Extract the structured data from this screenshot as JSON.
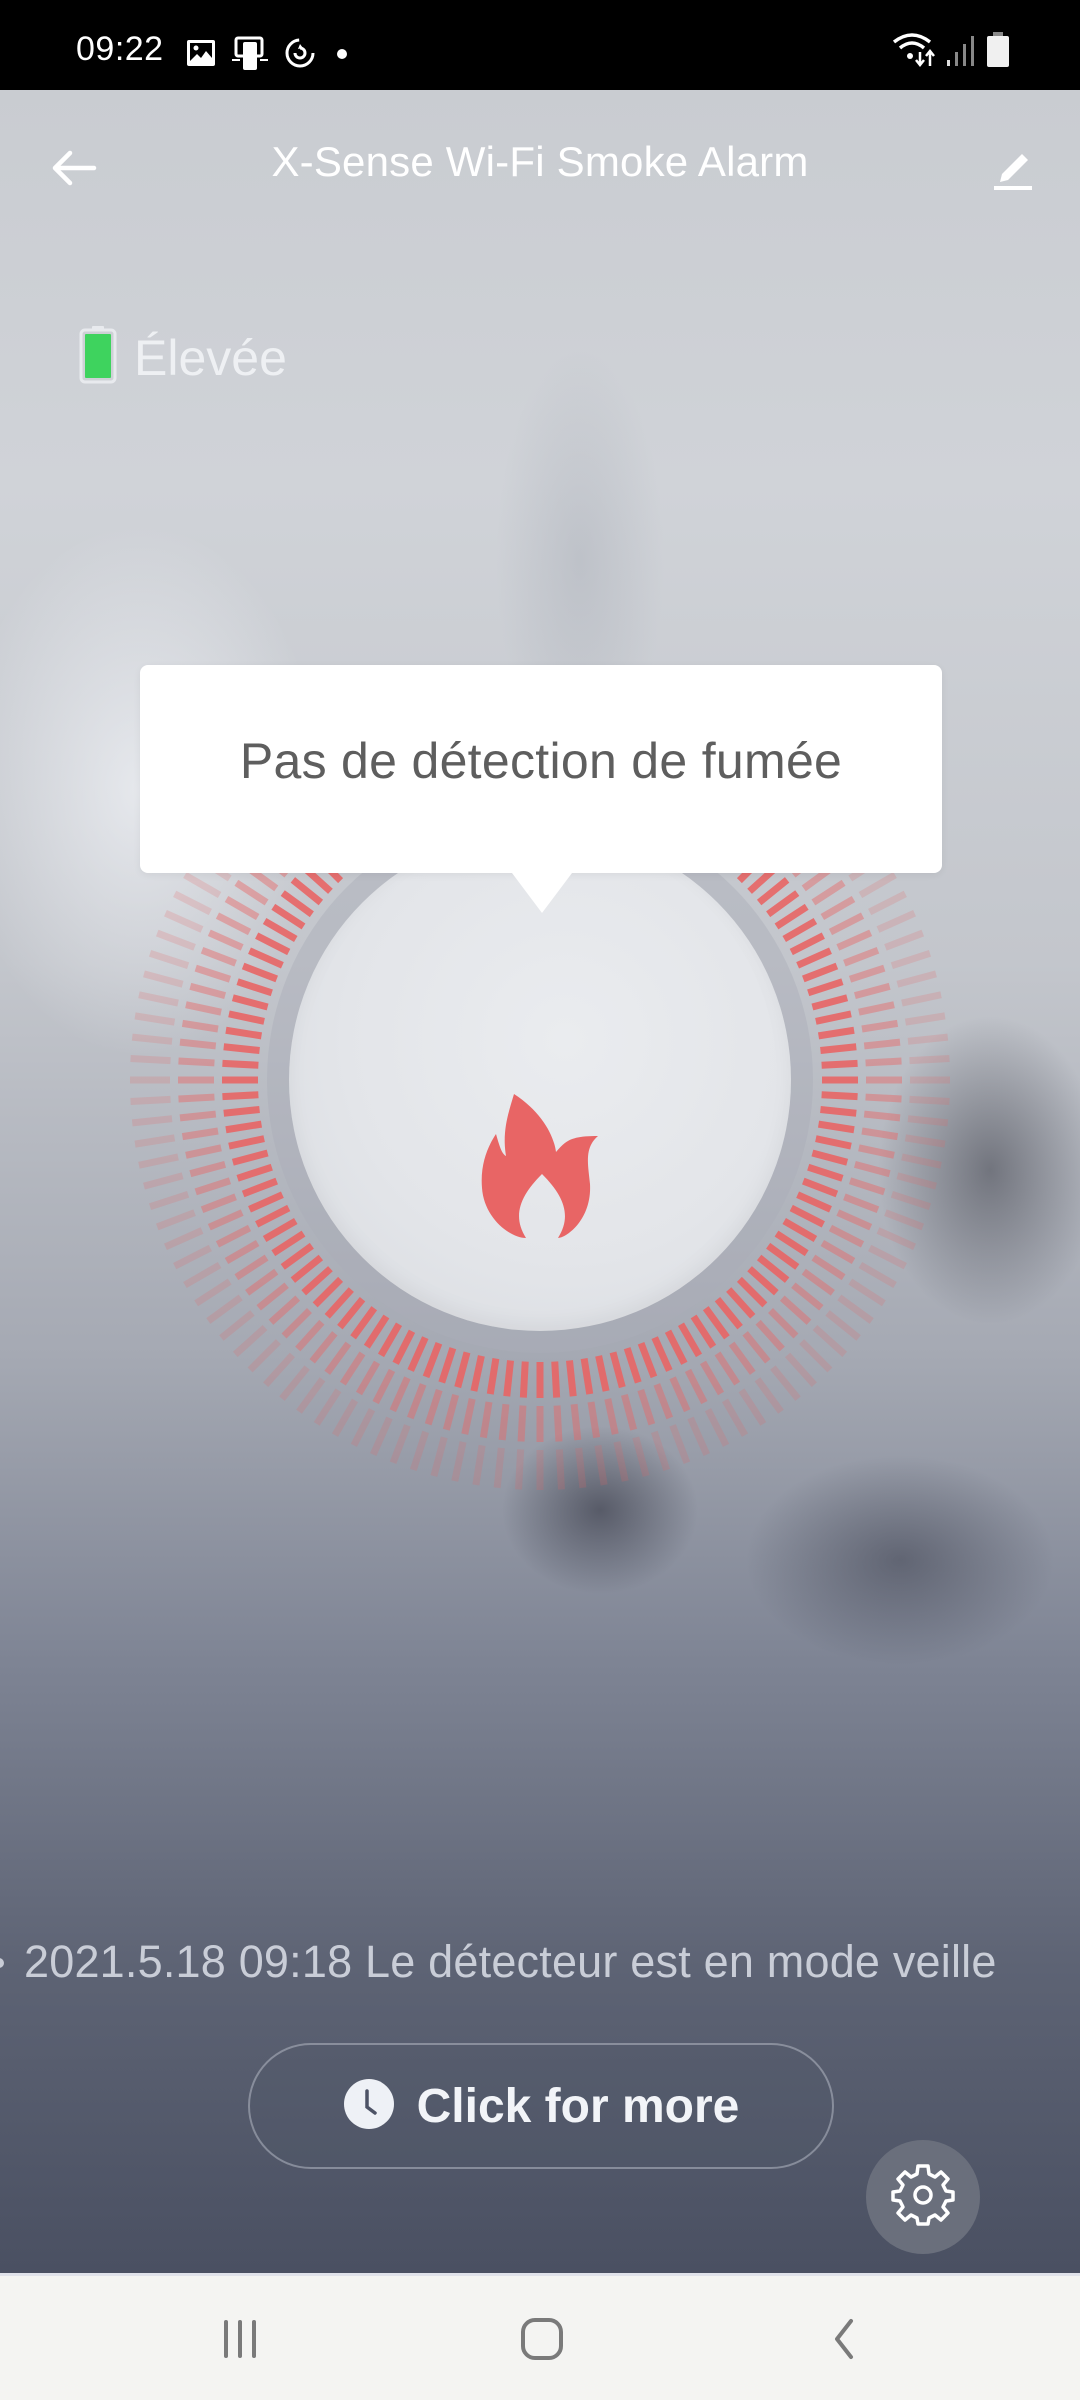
{
  "status_bar": {
    "time": "09:22",
    "left_icons": [
      "gallery-icon",
      "device-icon",
      "sync-icon",
      "dot-icon"
    ],
    "right_icons": [
      "wifi-icon",
      "signal-icon",
      "battery-icon"
    ]
  },
  "header": {
    "title": "X-Sense Wi-Fi Smoke Alarm",
    "back_icon": "arrow-left-icon",
    "edit_icon": "pencil-icon"
  },
  "battery": {
    "label": "Élevée",
    "level": "high",
    "color": "#3ed35e"
  },
  "status": {
    "tooltip_text": "Pas de détection de fumée",
    "icon": "flame-icon",
    "accent_color": "#e86565"
  },
  "ticker": {
    "text": "2021.5.18 09:18 Le détecteur est en mode veille"
  },
  "actions": {
    "more_label": "Click for more",
    "more_icon": "clock-icon",
    "settings_icon": "gear-icon"
  },
  "nav_bar": {
    "items": [
      "recent-apps",
      "home",
      "back"
    ]
  }
}
